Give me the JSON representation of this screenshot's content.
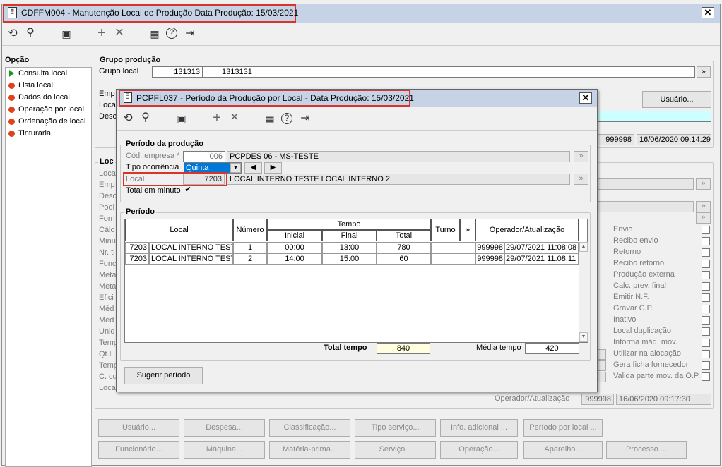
{
  "main": {
    "title": "CDFFM004 - Manutenção Local de Produção Data Produção: 15/03/2021",
    "opcao_label": "Opção",
    "options": [
      "Consulta local",
      "Lista local",
      "Dados do local",
      "Operação por local",
      "Ordenação de local",
      "Tinturaria"
    ],
    "grupo_producao": {
      "title": "Grupo produção",
      "grupo_local_label": "Grupo local",
      "value1": "131313",
      "value2": "1313131"
    },
    "partial_labels_top": [
      "Emp",
      "Loca",
      "Desc"
    ],
    "usuario_button": "Usuário...",
    "operator_top": "999998",
    "timestamp_top": "16/06/2020 09:14:29",
    "loc_group_title": "Loc",
    "partial_labels_left": [
      "Loca",
      "Emp",
      "Desc",
      "Pool",
      "Forn",
      "Cálc",
      "Minu",
      "Nr. ti",
      "Func",
      "Meta",
      "Meta",
      "Efici",
      "Méd",
      "Méd",
      "Unid",
      "Temp",
      "Qt.L",
      "Temp",
      "C. cu",
      "Loca"
    ],
    "right_checks": [
      "Envio",
      "Recibo envio",
      "Retorno",
      "Recibo retorno",
      "Produção externa",
      "Calc. prev. final",
      "Emitir N.F.",
      "Gravar C.P.",
      "Inativo",
      "Local duplicação",
      "Informa máq. mov.",
      "Utilizar na alocação",
      "Gera ficha fornecedor",
      "Valida parte mov. da O.P."
    ],
    "operador_label": "Operador/Atualização",
    "operator_bottom": "999998",
    "timestamp_bottom": "16/06/2020 09:17:30",
    "buttons_row1": [
      "Usuário...",
      "Despesa...",
      "Classificação...",
      "Tipo serviço...",
      "Info. adicional ...",
      "Período por local ..."
    ],
    "buttons_row2": [
      "Funcionário...",
      "Máquina...",
      "Matéria-prima...",
      "Serviço...",
      "Operação...",
      "Aparelho...",
      "Processo ..."
    ]
  },
  "dialog": {
    "title": "PCPFL037 - Período da Produção por Local - Data Produção: 15/03/2021",
    "periodo_producao": "Período da produção",
    "cod_empresa_label": "Cód. empresa *",
    "cod_empresa_value": "006",
    "empresa_desc": "PCPDES 06 - MS-TESTE",
    "tipo_ocorrencia_label": "Tipo ocorrência",
    "tipo_ocorrencia_value": "Quinta",
    "local_label": "Local",
    "local_value": "7203",
    "local_desc": "LOCAL INTERNO TESTE LOCAL INTERNO 2",
    "total_minuto_label": "Total em minuto",
    "periodo_title": "Período",
    "headers": {
      "local": "Local",
      "numero": "Número",
      "tempo": "Tempo",
      "inicial": "Inicial",
      "final": "Final",
      "total": "Total",
      "turno": "Turno",
      "more": "»",
      "operador": "Operador/Atualização"
    },
    "rows": [
      {
        "code": "7203",
        "local": "LOCAL INTERNO TESTE",
        "numero": "1",
        "inicial": "00:00",
        "final": "13:00",
        "total": "780",
        "turno": "",
        "operador": "999998",
        "data": "29/07/2021 11:08:08"
      },
      {
        "code": "7203",
        "local": "LOCAL INTERNO TESTE",
        "numero": "2",
        "inicial": "14:00",
        "final": "15:00",
        "total": "60",
        "turno": "",
        "operador": "999998",
        "data": "29/07/2021 11:08:11"
      }
    ],
    "total_tempo_label": "Total tempo",
    "total_tempo_value": "840",
    "media_tempo_label": "Média tempo",
    "media_tempo_value": "420",
    "sugerir_button": "Sugerir período"
  },
  "colors": {
    "title_bar": "#c6d3e6",
    "highlight": "#d9342b",
    "selection": "#0078d7",
    "cyan_field": "#ccffff",
    "total_field": "#ffffe0"
  }
}
